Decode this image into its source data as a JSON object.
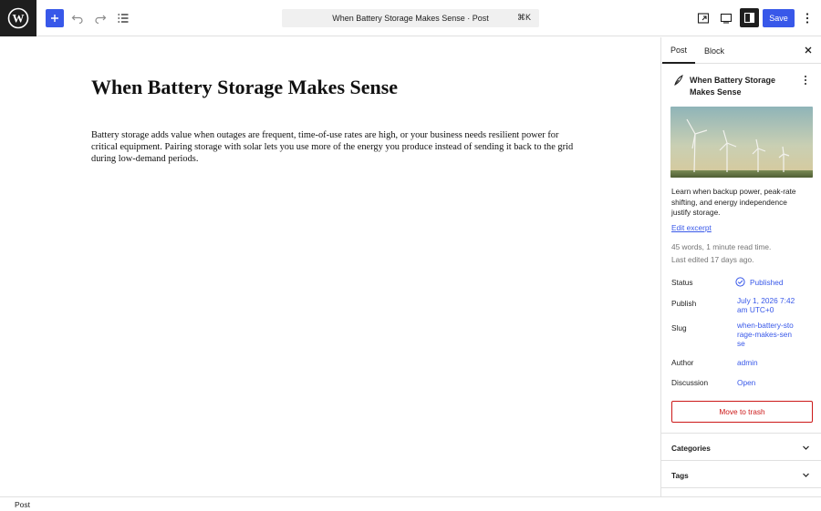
{
  "colors": {
    "accent": "#3858e9",
    "danger": "#cc1818",
    "dark": "#1e1e1e",
    "muted": "#757575"
  },
  "topbar": {
    "document_title": "When Battery Storage Makes Sense · Post",
    "shortcut": "⌘K",
    "save_label": "Save",
    "icons": [
      "wordpress-logo",
      "plus-icon",
      "undo-icon",
      "redo-icon",
      "list-view-icon",
      "view-icon",
      "preview-device-icon",
      "settings-sidebar-icon",
      "more-options-icon"
    ]
  },
  "post": {
    "title": "When Battery Storage Makes Sense",
    "body": "Battery storage adds value when outages are frequent, time-of-use rates are high, or your business needs resilient power for critical equipment. Pairing storage with solar lets you use more of the energy you produce instead of sending it back to the grid during low-demand periods."
  },
  "sidebar": {
    "tabs": [
      {
        "label": "Post",
        "active": true
      },
      {
        "label": "Block",
        "active": false
      }
    ],
    "summary_title": "When Battery Storage Makes Sense",
    "excerpt": "Learn when backup power, peak-rate shifting, and energy independence justify storage.",
    "edit_excerpt": "Edit excerpt",
    "word_info": "45 words, 1 minute read time.",
    "last_edited": "Last edited 17 days ago.",
    "rows": {
      "status": {
        "label": "Status",
        "value": "Published"
      },
      "publish": {
        "label": "Publish",
        "value": "July 1, 2026 7:42 am UTC+0"
      },
      "slug": {
        "label": "Slug",
        "value": "when-battery-storage-makes-sense"
      },
      "author": {
        "label": "Author",
        "value": "admin"
      },
      "discussion": {
        "label": "Discussion",
        "value": "Open"
      }
    },
    "trash_label": "Move to trash",
    "panels": [
      {
        "label": "Categories"
      },
      {
        "label": "Tags"
      }
    ]
  },
  "footer": {
    "breadcrumb": "Post"
  }
}
